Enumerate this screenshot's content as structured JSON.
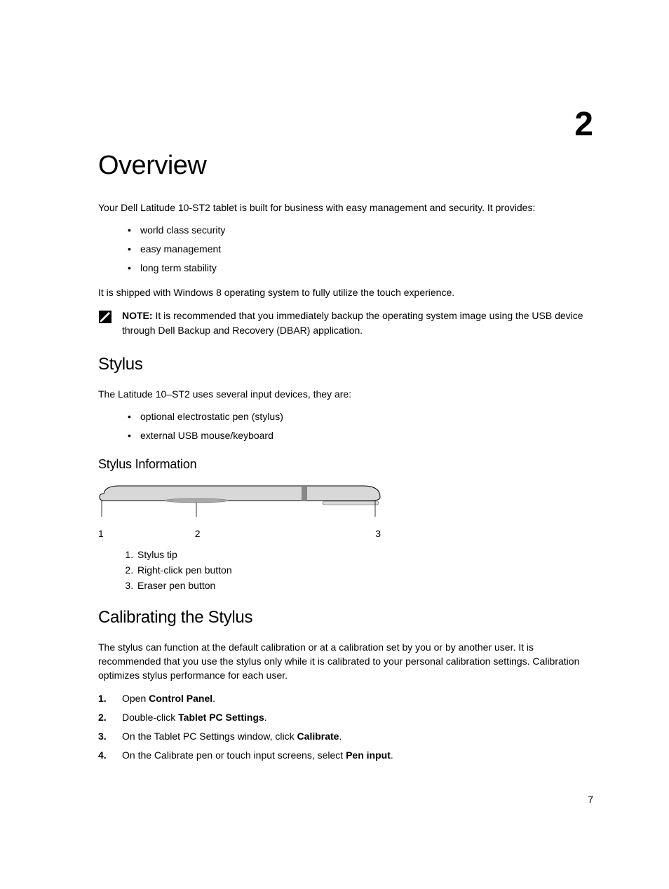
{
  "chapter_number": "2",
  "page_number": "7",
  "h1": "Overview",
  "intro": "Your Dell Latitude 10-ST2 tablet is built for business with easy management and security. It provides:",
  "intro_bullets": [
    "world class security",
    "easy management",
    "long term stability"
  ],
  "intro2": "It is shipped with Windows 8 operating system to fully utilize the touch experience.",
  "note_label": "NOTE:",
  "note_text": " It is recommended that you immediately backup the operating system image using the USB device through Dell Backup and Recovery (DBAR) application.",
  "h2_stylus": "Stylus",
  "stylus_intro": "The Latitude 10–ST2 uses several input devices, they are:",
  "stylus_bullets": [
    "optional electrostatic pen (stylus)",
    "external USB mouse/keyboard"
  ],
  "h3_stylus_info": "Stylus Information",
  "callouts": {
    "c1": "1",
    "c2": "2",
    "c3": "3"
  },
  "parts": [
    "Stylus tip",
    "Right-click pen button",
    "Eraser pen button"
  ],
  "h2_calib": "Calibrating the Stylus",
  "calib_para": "The stylus can function at the default calibration or at a calibration set by you or by another user. It is recommended that you use the stylus only while it is calibrated to your personal calibration settings. Calibration optimizes stylus performance for each user.",
  "steps": {
    "s1_a": "Open ",
    "s1_b": "Control Panel",
    "s1_c": ".",
    "s2_a": "Double-click ",
    "s2_b": "Tablet PC Settings",
    "s2_c": ".",
    "s3_a": "On the Tablet PC Settings window, click ",
    "s3_b": "Calibrate",
    "s3_c": ".",
    "s4_a": "On the Calibrate pen or touch input screens, select ",
    "s4_b": "Pen input",
    "s4_c": "."
  }
}
